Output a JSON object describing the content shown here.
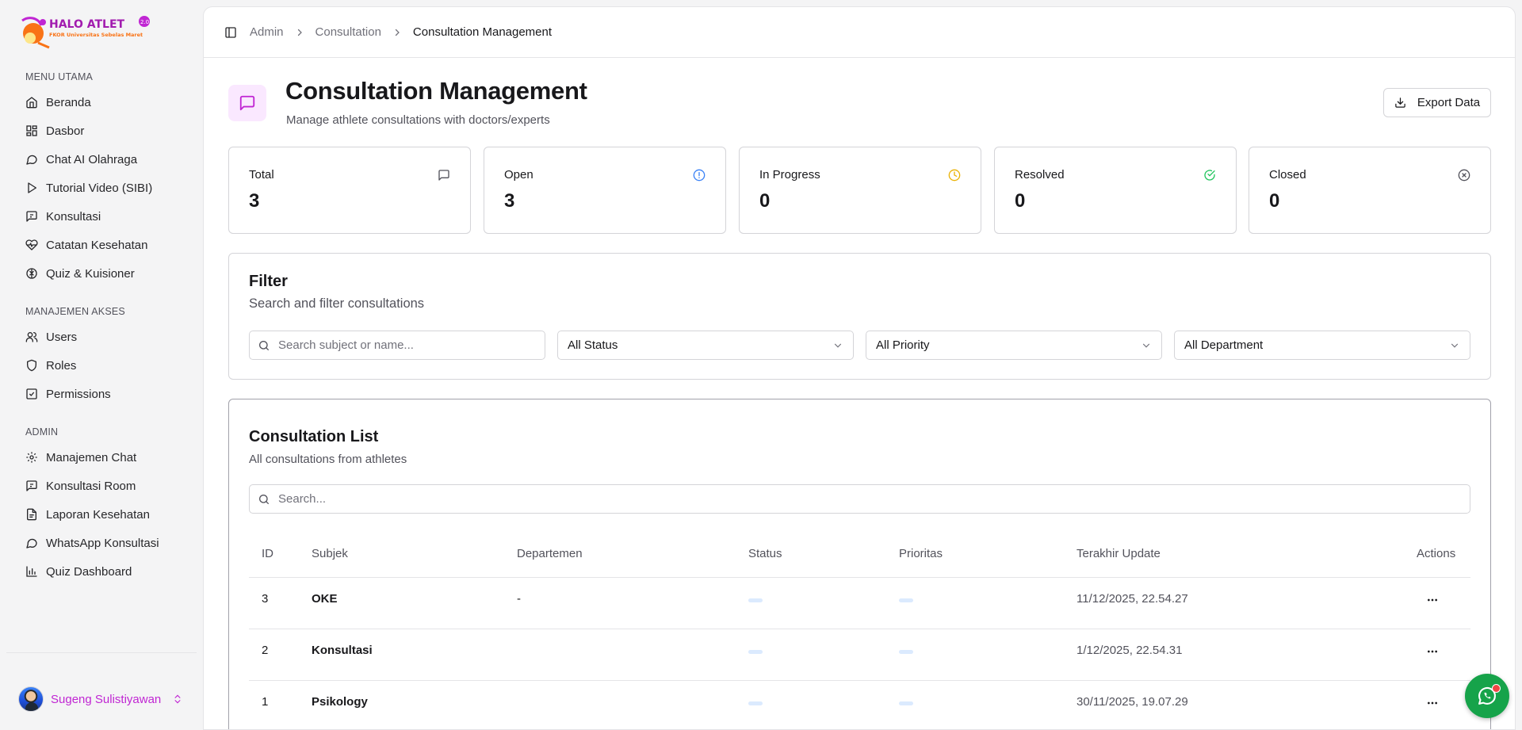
{
  "app": {
    "logo_text": "HALO ATLET",
    "logo_version": "2.0",
    "logo_subtitle": "FKOR Universitas Sebelas Maret"
  },
  "sidebar": {
    "sections": [
      {
        "title": "MENU UTAMA",
        "items": [
          {
            "label": "Beranda",
            "icon": "home-icon"
          },
          {
            "label": "Dasbor",
            "icon": "dashboard-grid-icon"
          },
          {
            "label": "Chat AI Olahraga",
            "icon": "chat-bubble-icon"
          },
          {
            "label": "Tutorial Video (SIBI)",
            "icon": "play-icon"
          },
          {
            "label": "Konsultasi",
            "icon": "message-square-icon"
          },
          {
            "label": "Catatan Kesehatan",
            "icon": "heart-pulse-icon"
          },
          {
            "label": "Quiz & Kuisioner",
            "icon": "brain-icon"
          }
        ]
      },
      {
        "title": "MANAJEMEN AKSES",
        "items": [
          {
            "label": "Users",
            "icon": "users-icon"
          },
          {
            "label": "Roles",
            "icon": "shield-icon"
          },
          {
            "label": "Permissions",
            "icon": "permission-check-icon"
          }
        ]
      },
      {
        "title": "ADMIN",
        "items": [
          {
            "label": "Manajemen Chat",
            "icon": "gear-icon"
          },
          {
            "label": "Konsultasi Room",
            "icon": "message-square-icon"
          },
          {
            "label": "Laporan Kesehatan",
            "icon": "report-icon"
          },
          {
            "label": "WhatsApp Konsultasi",
            "icon": "chat-bubble-icon"
          },
          {
            "label": "Quiz Dashboard",
            "icon": "bar-chart-icon"
          }
        ]
      }
    ],
    "user": {
      "name": "Sugeng Sulistiyawan"
    }
  },
  "breadcrumb": [
    "Admin",
    "Consultation",
    "Consultation Management"
  ],
  "page": {
    "title": "Consultation Management",
    "subtitle": "Manage athlete consultations with doctors/experts",
    "export_label": "Export Data"
  },
  "stats": [
    {
      "label": "Total",
      "value": "3",
      "icon": "message-square-icon",
      "color": "#52525b"
    },
    {
      "label": "Open",
      "value": "3",
      "icon": "alert-circle-icon",
      "color": "#3b82f6"
    },
    {
      "label": "In Progress",
      "value": "0",
      "icon": "clock-icon",
      "color": "#eab308"
    },
    {
      "label": "Resolved",
      "value": "0",
      "icon": "check-circle-icon",
      "color": "#22c55e"
    },
    {
      "label": "Closed",
      "value": "0",
      "icon": "x-circle-icon",
      "color": "#52525b"
    }
  ],
  "filter": {
    "title": "Filter",
    "subtitle": "Search and filter consultations",
    "search_placeholder": "Search subject or name...",
    "status_value": "All Status",
    "priority_value": "All Priority",
    "department_value": "All Department"
  },
  "list": {
    "title": "Consultation List",
    "subtitle": "All consultations from athletes",
    "search_placeholder": "Search...",
    "columns": [
      "ID",
      "Subjek",
      "Departemen",
      "Status",
      "Prioritas",
      "Terakhir Update",
      "Actions"
    ],
    "rows": [
      {
        "id": "3",
        "subject": "OKE",
        "department": "-",
        "updated": "11/12/2025, 22.54.27"
      },
      {
        "id": "2",
        "subject": "Konsultasi",
        "department": "",
        "updated": "1/12/2025, 22.54.31"
      },
      {
        "id": "1",
        "subject": "Psikology",
        "department": "",
        "updated": "30/11/2025, 19.07.29"
      }
    ]
  },
  "colors": {
    "accent": "#c026d3",
    "accent_bg": "#fae8ff",
    "whatsapp": "#16a34a",
    "notification": "#ef4444"
  }
}
